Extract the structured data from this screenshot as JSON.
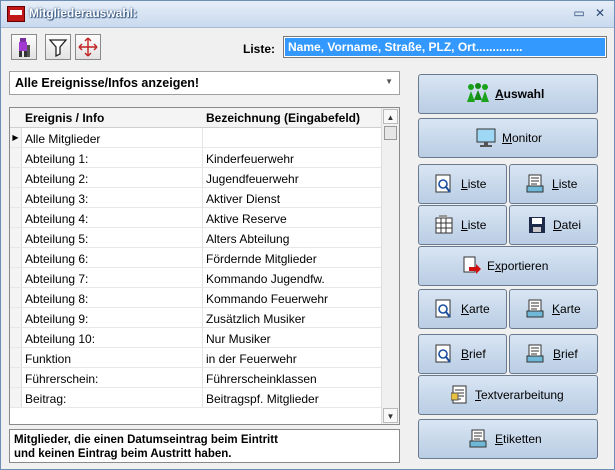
{
  "window": {
    "title": "Mitgliederauswahl:",
    "min_glyph": "▭",
    "close_glyph": "✕"
  },
  "toolbar": {
    "tools": [
      {
        "icon": "person-filter-icon"
      },
      {
        "icon": "funnel-icon"
      },
      {
        "icon": "expand-arrows-icon"
      }
    ],
    "liste_label": "Liste:",
    "liste_value": "Name, Vorname, Straße, PLZ, Ort.............."
  },
  "filter_combo": {
    "value": "Alle Ereignisse/Infos anzeigen!"
  },
  "grid": {
    "headers": [
      "Ereignis / Info",
      "Bezeichnung (Eingabefeld)"
    ],
    "rows": [
      {
        "info": "Alle Mitglieder",
        "bez": "",
        "current": "▶"
      },
      {
        "info": "Abteilung 1:",
        "bez": "Kinderfeuerwehr",
        "current": ""
      },
      {
        "info": "Abteilung 2:",
        "bez": "Jugendfeuerwehr",
        "current": ""
      },
      {
        "info": "Abteilung 3:",
        "bez": "Aktiver Dienst",
        "current": ""
      },
      {
        "info": "Abteilung 4:",
        "bez": "Aktive Reserve",
        "current": ""
      },
      {
        "info": "Abteilung 5:",
        "bez": "Alters Abteilung",
        "current": ""
      },
      {
        "info": "Abteilung 6:",
        "bez": "Fördernde Mitglieder",
        "current": ""
      },
      {
        "info": "Abteilung 7:",
        "bez": "Kommando Jugendfw.",
        "current": ""
      },
      {
        "info": "Abteilung 8:",
        "bez": "Kommando Feuerwehr",
        "current": ""
      },
      {
        "info": "Abteilung 9:",
        "bez": "Zusätzlich Musiker",
        "current": ""
      },
      {
        "info": "Abteilung 10:",
        "bez": "Nur Musiker",
        "current": ""
      },
      {
        "info": "Funktion",
        "bez": "in der Feuerwehr",
        "current": ""
      },
      {
        "info": "Führerschein:",
        "bez": "Führerscheinklassen",
        "current": ""
      },
      {
        "info": "Beitrag:",
        "bez": "Beitragspf. Mitglieder",
        "current": ""
      }
    ]
  },
  "status": {
    "line1": "Mitglieder, die einen Datumseintrag beim Eintritt",
    "line2": "und keinen Eintrag beim Austritt haben."
  },
  "buttons": {
    "auswahl": {
      "u": "A",
      "rest": "uswahl"
    },
    "monitor": {
      "u": "M",
      "rest": "onitor"
    },
    "liste_search": {
      "u": "L",
      "rest": "iste"
    },
    "liste_print": {
      "u": "L",
      "rest": "iste"
    },
    "liste_table": {
      "u": "L",
      "rest": "iste"
    },
    "datei": {
      "u": "D",
      "rest": "atei"
    },
    "exportieren": {
      "pre": "E",
      "u": "x",
      "rest": "portieren"
    },
    "karte_search": {
      "u": "K",
      "rest": "arte"
    },
    "karte_print": {
      "u": "K",
      "rest": "arte"
    },
    "brief_search": {
      "u": "B",
      "rest": "rief"
    },
    "brief_print": {
      "u": "B",
      "rest": "rief"
    },
    "textverarbeitung": {
      "u": "T",
      "rest": "extverarbeitung"
    },
    "etiketten": {
      "u": "E",
      "rest": "tiketten"
    }
  },
  "colors": {
    "selection": "#3399ff",
    "button_top": "#d9e5f3",
    "button_bottom": "#b9cde4",
    "title_text": "#ffffff"
  }
}
